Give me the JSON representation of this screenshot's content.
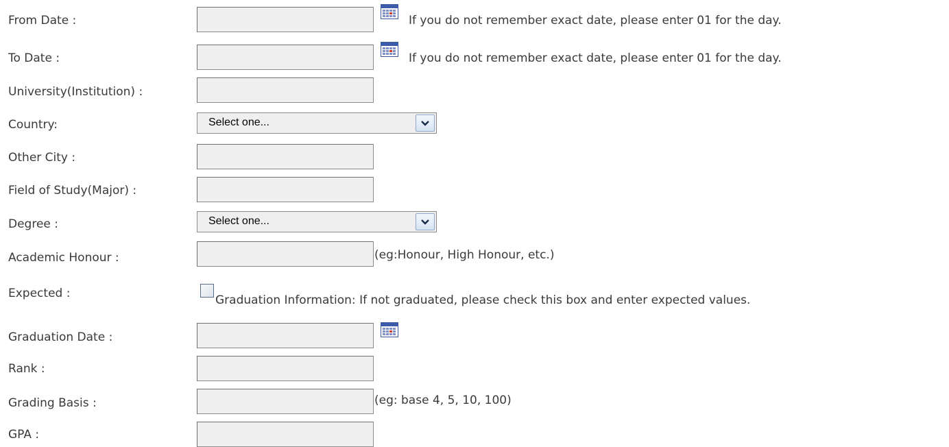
{
  "form": {
    "from_date": {
      "label": "From Date :",
      "value": "",
      "hint": "If you do not remember exact date, please enter 01 for the day."
    },
    "to_date": {
      "label": "To Date :",
      "value": "",
      "hint": "If you do not remember exact date, please enter 01 for the day."
    },
    "university": {
      "label": "University(Institution) :",
      "value": ""
    },
    "country": {
      "label": "Country:",
      "selected": "Select one..."
    },
    "other_city": {
      "label": "Other City :",
      "value": ""
    },
    "field_of_study": {
      "label": "Field of Study(Major) :",
      "value": ""
    },
    "degree": {
      "label": "Degree :",
      "selected": "Select one..."
    },
    "academic_honour": {
      "label": "Academic Honour :",
      "value": "",
      "hint": "(eg:Honour, High Honour, etc.)"
    },
    "expected": {
      "label": "Expected :",
      "checked": false,
      "hint": "Graduation Information: If not graduated, please check this box and enter expected values."
    },
    "graduation_date": {
      "label": "Graduation Date :",
      "value": ""
    },
    "rank": {
      "label": "Rank :",
      "value": ""
    },
    "grading_basis": {
      "label": "Grading Basis :",
      "value": "",
      "hint": "(eg: base 4, 5, 10, 100)"
    },
    "gpa": {
      "label": "GPA :",
      "value": ""
    }
  },
  "icons": {
    "calendar": "calendar-icon",
    "dropdown": "chevron-down-icon"
  },
  "colors": {
    "input_bg": "#efefef",
    "input_border": "#8a8a8a",
    "label_text": "#3a3a3a"
  }
}
